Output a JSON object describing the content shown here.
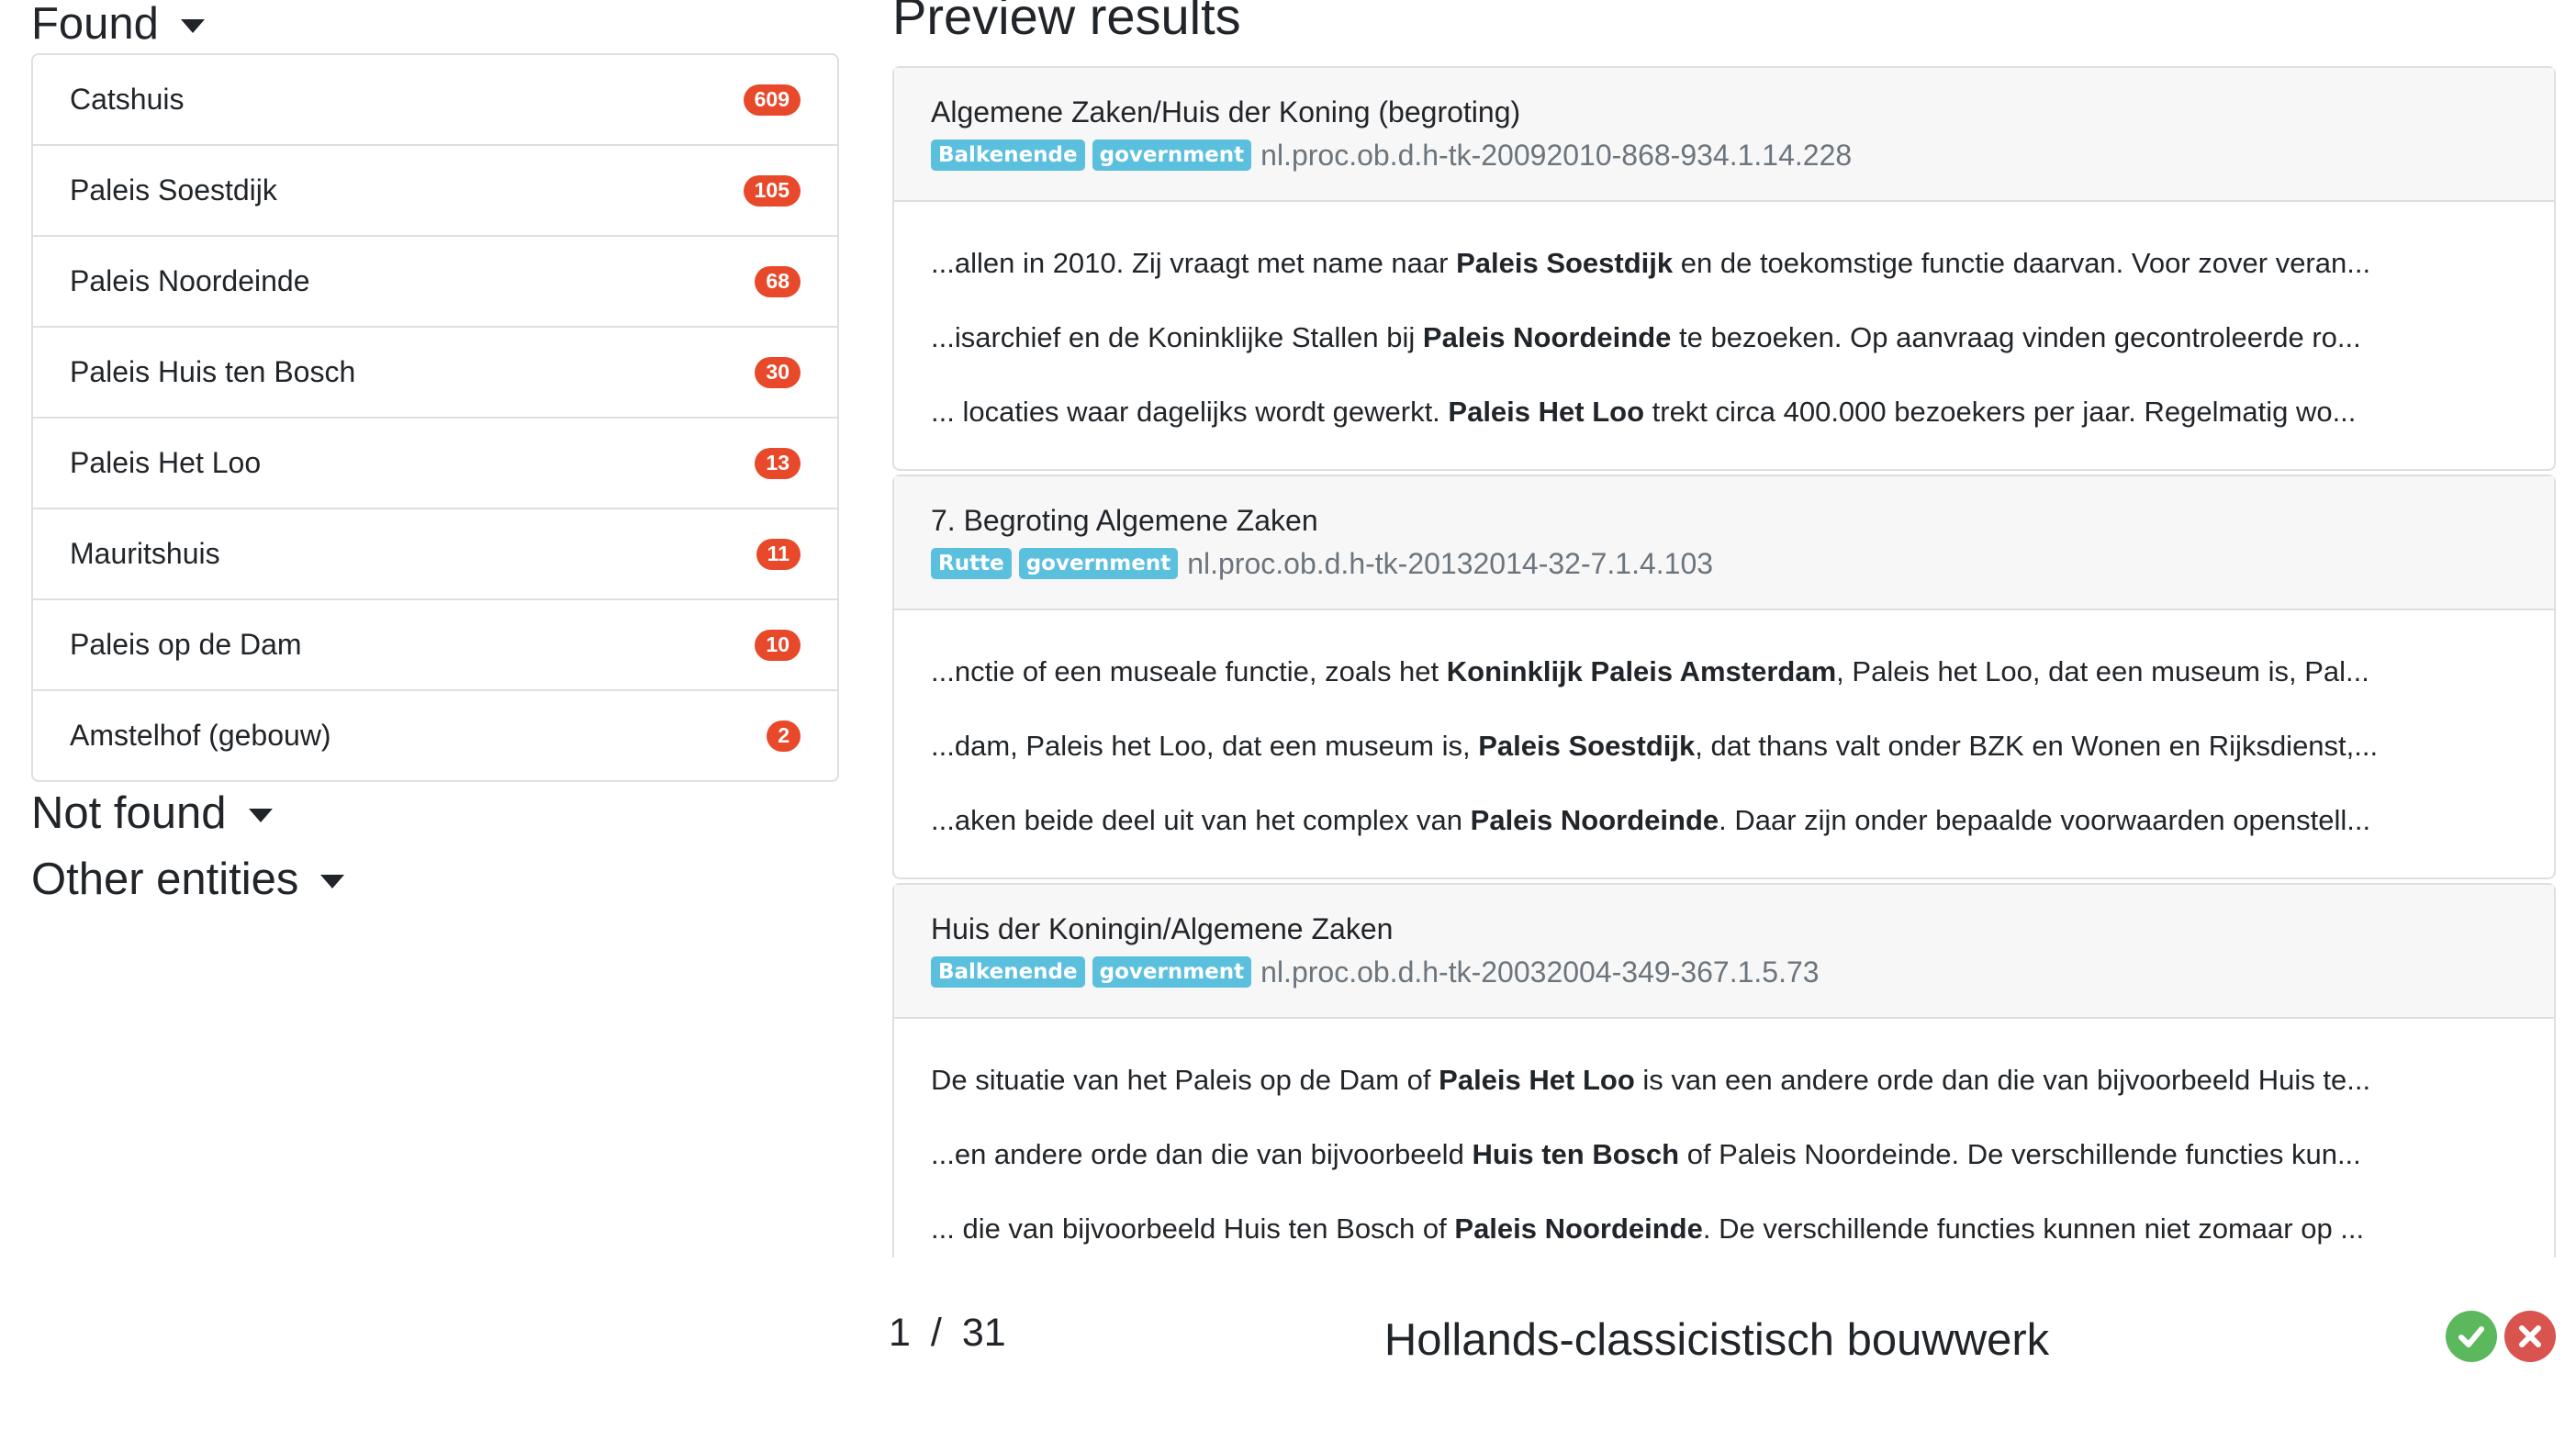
{
  "found": {
    "heading": "Found",
    "items": [
      {
        "label": "Catshuis",
        "count": "609"
      },
      {
        "label": "Paleis Soestdijk",
        "count": "105"
      },
      {
        "label": "Paleis Noordeinde",
        "count": "68"
      },
      {
        "label": "Paleis Huis ten Bosch",
        "count": "30"
      },
      {
        "label": "Paleis Het Loo",
        "count": "13"
      },
      {
        "label": "Mauritshuis",
        "count": "11"
      },
      {
        "label": "Paleis op de Dam",
        "count": "10"
      },
      {
        "label": "Amstelhof (gebouw)",
        "count": "2"
      }
    ]
  },
  "not_found": {
    "heading": "Not found"
  },
  "other_entities": {
    "heading": "Other entities"
  },
  "preview": {
    "title": "Preview results",
    "results": [
      {
        "title": "Algemene Zaken/Huis der Koning (begroting)",
        "tags": [
          "Balkenende",
          "government"
        ],
        "doc_id": "nl.proc.ob.d.h-tk-20092010-868-934.1.14.228",
        "snippets": [
          {
            "pre": "...allen in 2010. Zij vraagt met name naar ",
            "hit": "Paleis Soestdijk",
            "post": " en de toekomstige functie daarvan. Voor zover veran..."
          },
          {
            "pre": "...isarchief en de Koninklijke Stallen bij ",
            "hit": "Paleis Noordeinde",
            "post": " te bezoeken. Op aanvraag vinden gecontroleerde ro..."
          },
          {
            "pre": "... locaties waar dagelijks wordt gewerkt. ",
            "hit": "Paleis Het Loo",
            "post": " trekt circa 400.000 bezoekers per jaar. Regelmatig wo..."
          }
        ]
      },
      {
        "title": "7. Begroting Algemene Zaken",
        "tags": [
          "Rutte",
          "government"
        ],
        "doc_id": "nl.proc.ob.d.h-tk-20132014-32-7.1.4.103",
        "snippets": [
          {
            "pre": "...nctie of een museale functie, zoals het ",
            "hit": "Koninklijk Paleis Amsterdam",
            "post": ", Paleis het Loo, dat een museum is, Pal..."
          },
          {
            "pre": "...dam, Paleis het Loo, dat een museum is, ",
            "hit": "Paleis Soestdijk",
            "post": ", dat thans valt onder BZK en Wonen en Rijksdienst,..."
          },
          {
            "pre": "...aken beide deel uit van het complex van ",
            "hit": "Paleis Noordeinde",
            "post": ". Daar zijn onder bepaalde voorwaarden openstell..."
          }
        ]
      },
      {
        "title": "Huis der Koningin/Algemene Zaken",
        "tags": [
          "Balkenende",
          "government"
        ],
        "doc_id": "nl.proc.ob.d.h-tk-20032004-349-367.1.5.73",
        "snippets": [
          {
            "pre": "De situatie van het Paleis op de Dam of ",
            "hit": "Paleis Het Loo",
            "post": " is van een andere orde dan die van bijvoorbeeld Huis te..."
          },
          {
            "pre": "...en andere orde dan die van bijvoorbeeld ",
            "hit": "Huis ten Bosch",
            "post": " of Paleis Noordeinde. De verschillende functies kun..."
          },
          {
            "pre": "... die van bijvoorbeeld Huis ten Bosch of ",
            "hit": "Paleis Noordeinde",
            "post": ". De verschillende functies kunnen niet zomaar op ..."
          }
        ]
      }
    ]
  },
  "pager": {
    "current": "1",
    "separator": "/",
    "total": "31"
  },
  "entity_name": "Hollands-classicistisch bouwwerk",
  "actions": {
    "accept_icon": "check-circle-icon",
    "reject_icon": "x-circle-icon",
    "accept_color": "#5cb85c",
    "reject_color": "#d9534f"
  },
  "colors": {
    "count_badge": "#e8492a",
    "tag": "#5bc0de"
  }
}
